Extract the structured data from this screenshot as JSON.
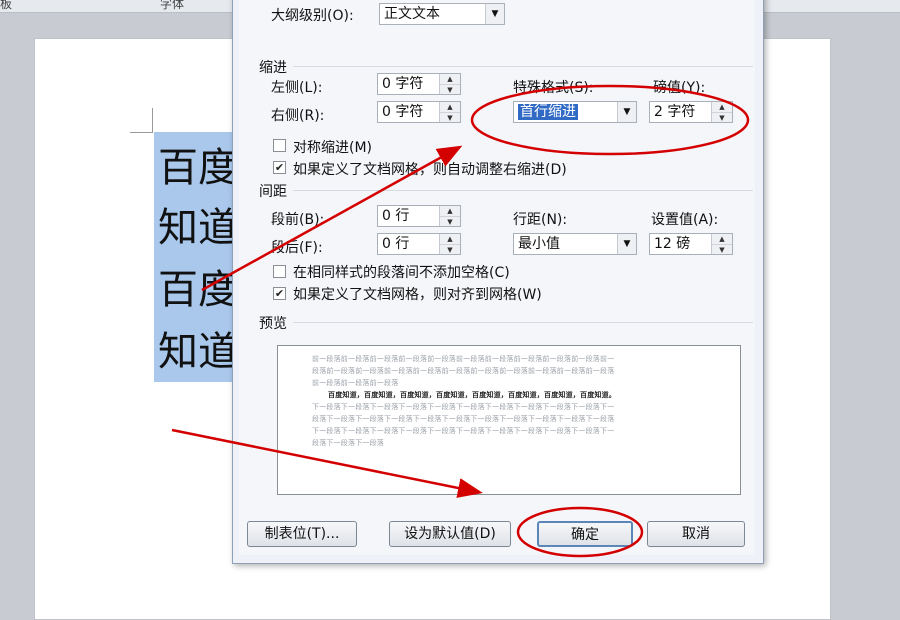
{
  "ribbon": {
    "left_label": "板",
    "center_label": "字体"
  },
  "document": {
    "lines": [
      "百度",
      "知道",
      "百度",
      "知道"
    ]
  },
  "dialog": {
    "outline_label": "大纲级别(O):",
    "outline_value": "正文文本",
    "indent": {
      "section": "缩进",
      "left_label": "左侧(L):",
      "left_value": "0 字符",
      "right_label": "右侧(R):",
      "right_value": "0 字符",
      "special_label": "特殊格式(S):",
      "special_value": "首行缩进",
      "by_label": "磅值(Y):",
      "by_value": "2 字符",
      "mirror_label": "对称缩进(M)",
      "mirror_checked": false,
      "auto_right_label": "如果定义了文档网格，则自动调整右缩进(D)",
      "auto_right_checked": true
    },
    "spacing": {
      "section": "间距",
      "before_label": "段前(B):",
      "before_value": "0 行",
      "after_label": "段后(F):",
      "after_value": "0 行",
      "line_label": "行距(N):",
      "line_value": "最小值",
      "at_label": "设置值(A):",
      "at_value": "12 磅",
      "no_space_label": "在相同样式的段落间不添加空格(C)",
      "no_space_checked": false,
      "snap_label": "如果定义了文档网格，则对齐到网格(W)",
      "snap_checked": true
    },
    "preview": {
      "section": "预览",
      "prev_lines": [
        "前一段落前一段落前一段落前一段落前一段落前一段落前一段落前一段落前一段落前一段落前一",
        "段落前一段落前一段落前一段落前一段落前一段落前一段落前一段落前一段落前一段落前一段落",
        "前一段落前一段落前一段落"
      ],
      "cur_line": "百度知道，百度知道，百度知道，百度知道，百度知道，百度知道，百度知道，百度知道。",
      "next_lines": [
        "下一段落下一段落下一段落下一段落下一段落下一段落下一段落下一段落下一段落下一段落下一",
        "段落下一段落下一段落下一段落下一段落下一段落下一段落下一段落下一段落下一段落下一段落",
        "下一段落下一段落下一段落下一段落下一段落下一段落下一段落下一段落下一段落下一段落下一",
        "段落下一段落下一段落"
      ]
    },
    "buttons": {
      "tabs": "制表位(T)...",
      "set_default": "设为默认值(D)",
      "ok": "确定",
      "cancel": "取消"
    }
  },
  "colors": {
    "annotation": "#d40000",
    "selection": "#a9c8ec"
  }
}
